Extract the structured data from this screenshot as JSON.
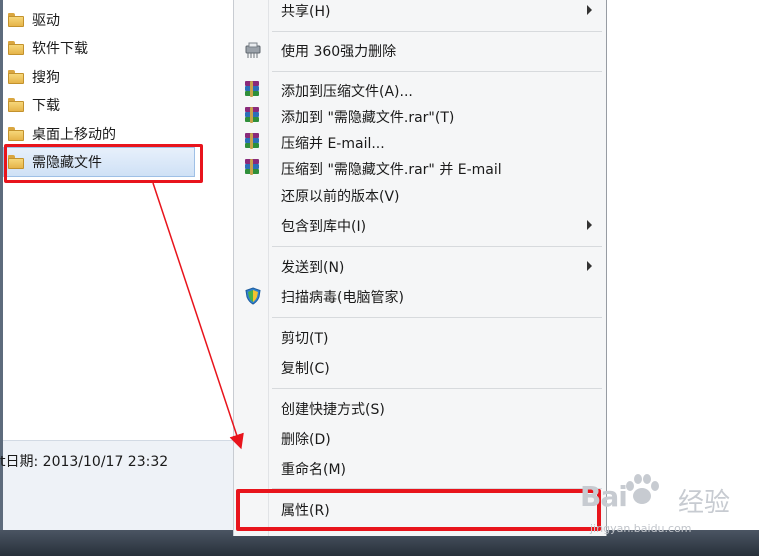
{
  "explorer": {
    "items": [
      {
        "label": "驱动"
      },
      {
        "label": "软件下载"
      },
      {
        "label": "搜狗"
      },
      {
        "label": "下载"
      },
      {
        "label": "桌面上移动的"
      },
      {
        "label": "需隐藏文件"
      }
    ],
    "details": "t日期: 2013/10/17 23:32"
  },
  "menu": {
    "share": "共享(H)",
    "delete360": "使用 360强力删除",
    "add_archive": "添加到压缩文件(A)...",
    "add_rar": "添加到 \"需隐藏文件.rar\"(T)",
    "compress_email": "压缩并 E-mail...",
    "compress_rar_email": "压缩到 \"需隐藏文件.rar\" 并 E-mail",
    "restore": "还原以前的版本(V)",
    "include_library": "包含到库中(I)",
    "send_to": "发送到(N)",
    "scan_virus": "扫描病毒(电脑管家)",
    "cut": "剪切(T)",
    "copy": "复制(C)",
    "create_shortcut": "创建快捷方式(S)",
    "delete": "删除(D)",
    "rename": "重命名(M)",
    "properties": "属性(R)"
  },
  "watermark": {
    "logo": "Bai",
    "text": "经验",
    "url": "jingyan.baidu.com"
  },
  "colors": {
    "highlight_red": "#e8141c",
    "selection_blue": "#cfe1f6"
  }
}
